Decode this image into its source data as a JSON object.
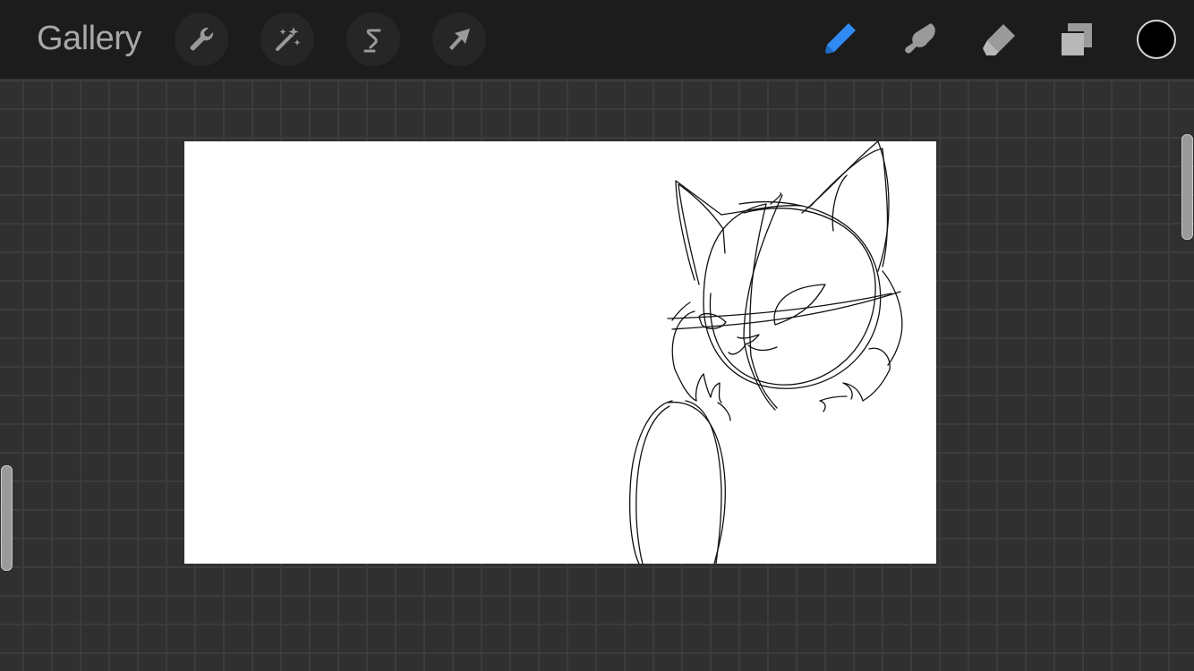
{
  "toolbar": {
    "gallery_label": "Gallery",
    "left_tools": [
      {
        "name": "actions",
        "icon": "wrench-icon"
      },
      {
        "name": "adjustments",
        "icon": "magic-wand-icon"
      },
      {
        "name": "selection",
        "icon": "selection-s-icon"
      },
      {
        "name": "transform",
        "icon": "arrow-cursor-icon"
      }
    ],
    "right_tools": [
      {
        "name": "paint",
        "icon": "pencil-icon",
        "active": true
      },
      {
        "name": "smudge",
        "icon": "smudge-finger-icon",
        "active": false
      },
      {
        "name": "erase",
        "icon": "eraser-icon",
        "active": false
      },
      {
        "name": "layers",
        "icon": "layers-icon",
        "active": false
      }
    ],
    "current_color": "#000000"
  },
  "colors": {
    "toolbar_bg": "#1c1c1c",
    "workspace_bg": "#303030",
    "grid_line": "#3c3c3c",
    "icon_inactive": "#9a9a9a",
    "accent": "#2f8bf2"
  },
  "sliders": {
    "brush_size_slider": "right",
    "opacity_slider": "left"
  }
}
